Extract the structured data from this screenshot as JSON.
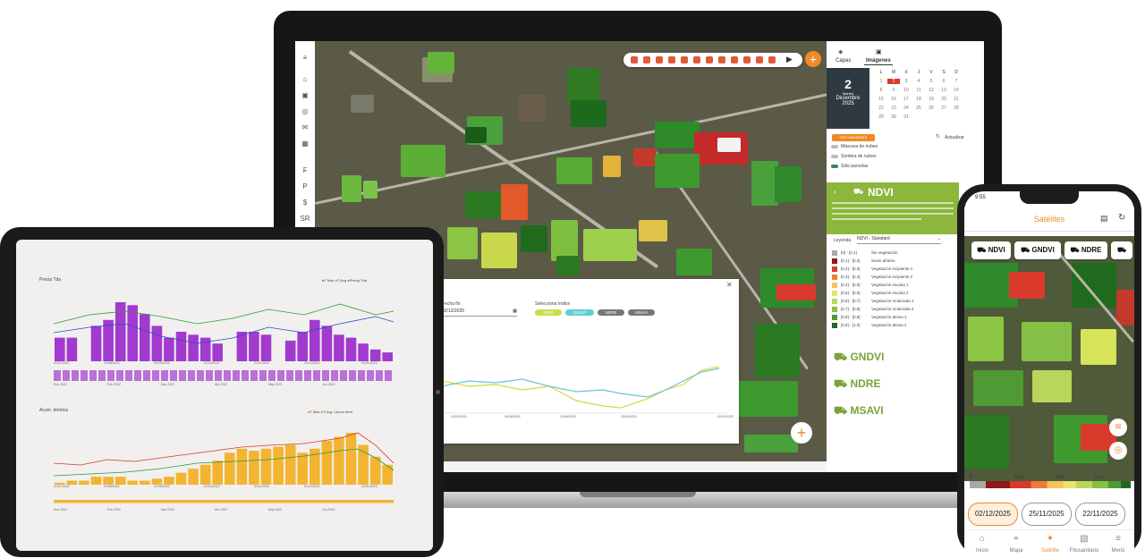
{
  "colors": {
    "accent": "#f08a24",
    "ndvi_green": "#8cb63c",
    "purple": "#a23ad0",
    "amber": "#f3b431"
  },
  "laptop": {
    "right_panel": {
      "tabs": [
        "Capas",
        "Imágenes"
      ],
      "date": {
        "day": "2",
        "weekday": "Martes",
        "month": "Diciembre",
        "year": "2025"
      },
      "calendar_header": [
        "L",
        "M",
        "X",
        "J",
        "V",
        "S",
        "D"
      ],
      "calendar_rows": [
        [
          "1",
          "2",
          "3",
          "4",
          "5",
          "6",
          "7"
        ],
        [
          "8",
          "9",
          "10",
          "11",
          "12",
          "13",
          "14"
        ],
        [
          "15",
          "16",
          "17",
          "18",
          "19",
          "20",
          "21"
        ],
        [
          "22",
          "23",
          "24",
          "25",
          "26",
          "27",
          "28"
        ],
        [
          "29",
          "30",
          "31",
          "",
          "",
          "",
          ""
        ]
      ],
      "action_button": "VER IMÁGENES",
      "refresh": "Actualizar",
      "toggles": [
        "Máscara de nubes",
        "Sombra de nubes",
        "Sólo parcelas"
      ],
      "index_title": "NDVI",
      "legend_label": "Leyenda",
      "legend_select": "NDVI - Standard",
      "legend": [
        {
          "range": "[0] - [0.1]",
          "label": "Sin vegetación",
          "color": "#a8a8a8"
        },
        {
          "range": "[0.1] - [0.2]",
          "label": "Suelo abierto",
          "color": "#8b1a1a"
        },
        {
          "range": "[0.2] - [0.3]",
          "label": "Vegetación incipiente 1",
          "color": "#d93a2b"
        },
        {
          "range": "[0.3] - [0.4]",
          "label": "Vegetación incipiente 2",
          "color": "#f07a3a"
        },
        {
          "range": "[0.4] - [0.5]",
          "label": "Vegetación escasa 1",
          "color": "#f6c45a"
        },
        {
          "range": "[0.5] - [0.6]",
          "label": "Vegetación escasa 2",
          "color": "#e8e36a"
        },
        {
          "range": "[0.6] - [0.7]",
          "label": "Vegetación moderada 1",
          "color": "#b9d65a"
        },
        {
          "range": "[0.7] - [0.8]",
          "label": "Vegetación moderada 2",
          "color": "#86bf45"
        },
        {
          "range": "[0.8] - [0.9]",
          "label": "Vegetación densa 1",
          "color": "#4f9a34"
        },
        {
          "range": "[0.9] - [1.0]",
          "label": "Vegetación densa 2",
          "color": "#24661f"
        }
      ],
      "other_indices": [
        "GNDVI",
        "NDRE",
        "MSAVI"
      ]
    },
    "popup": {
      "date_label": "Fecha fin",
      "date_value": "02/12/2025",
      "index_label": "Selecciona índice",
      "chips": [
        "NDVI",
        "GNDVI",
        "NDRE",
        "MSAVI"
      ],
      "x_ticks": [
        "10/02/2025",
        "06/05/2025",
        "12/08/2025",
        "15/09/2025",
        "02/12/2025"
      ]
    }
  },
  "tablet": {
    "chart1": {
      "title": "Precip Tda",
      "legend": [
        "T Max",
        "T Avg",
        "Precip Tda"
      ],
      "x_ticks": [
        "01/07/2022",
        "01/08/2022",
        "01/09/2022",
        "01/10/2022",
        "01/11/2022",
        "01/12/2022",
        "01/01/2023"
      ],
      "mini_ticks": [
        "Ene 2022",
        "Feb 2022",
        "Mar 2022",
        "Abr 2022",
        "May 2022",
        "Jun 2022"
      ],
      "bars": [
        8,
        8,
        0,
        12,
        14,
        20,
        19,
        16,
        12,
        8,
        10,
        9,
        8,
        6,
        0,
        10,
        10,
        9,
        0,
        7,
        10,
        14,
        12,
        9,
        8,
        6,
        4,
        3
      ]
    },
    "chart2": {
      "title": "Acum. térmica",
      "legend": [
        "T Max",
        "T Avg",
        "Acum térm."
      ],
      "x_ticks": [
        "01/07/2022",
        "01/08/2022",
        "01/09/2022",
        "01/10/2022",
        "01/11/2022",
        "01/12/2022",
        "01/01/2023"
      ],
      "mini_ticks": [
        "Ene 2022",
        "Feb 2022",
        "Mar 2022",
        "Abr 2022",
        "May 2022",
        "Jun 2022"
      ],
      "bars": [
        1,
        2,
        2,
        4,
        4,
        4,
        2,
        2,
        3,
        4,
        6,
        8,
        10,
        12,
        16,
        18,
        17,
        18,
        19,
        20,
        16,
        18,
        22,
        24,
        26,
        20,
        14,
        10
      ]
    }
  },
  "phone": {
    "status_time": "9:55",
    "header_title": "Satélites",
    "pills": [
      "NDVI",
      "GNDVI",
      "NDRE"
    ],
    "scale_labels": [
      "0",
      "0.16",
      "0.45",
      "0.73"
    ],
    "dates": [
      "02/12/2025",
      "25/11/2025",
      "22/11/2025"
    ],
    "nav": [
      "Inicio",
      "Mapa",
      "Satélite",
      "Fitosanitario",
      "Menú"
    ]
  }
}
